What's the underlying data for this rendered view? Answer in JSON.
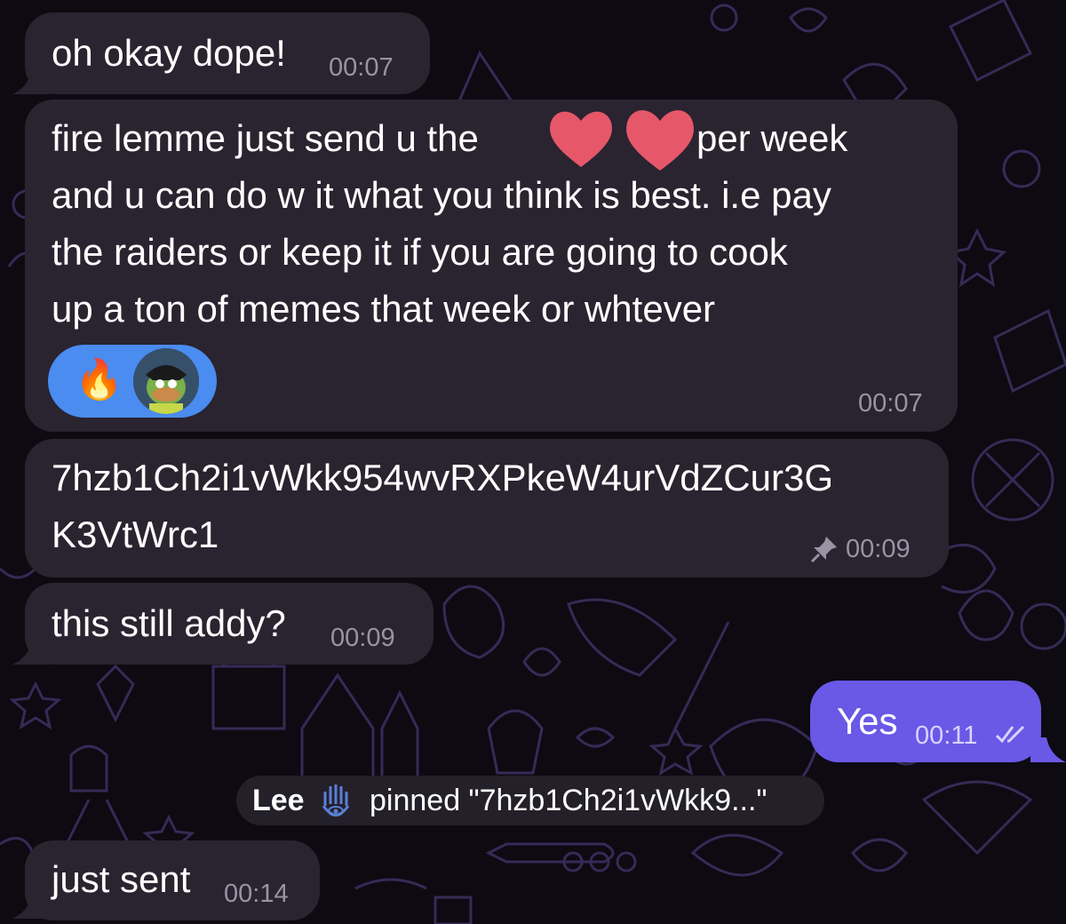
{
  "messages": [
    {
      "text": "oh okay dope!",
      "time": "00:07"
    },
    {
      "lines": [
        "fire lemme just send u the",
        "per week",
        "and u can do w it what you think is best. i.e pay",
        "the raiders or keep it if you are going to cook",
        "up a ton of memes that week or whtever"
      ],
      "time": "00:07",
      "reactions": [
        {
          "icon": "fire-emoji"
        },
        {
          "icon": "user-avatar"
        }
      ]
    },
    {
      "lines": [
        "7hzb1Ch2i1vWkk954wvRXPkeW4urVdZCur3G",
        "K3VtWrc1"
      ],
      "time": "00:09",
      "pinned_icon": "pin-icon"
    },
    {
      "text": "this still addy?",
      "time": "00:09"
    },
    {
      "text": "Yes",
      "time": "00:11",
      "status_icon": "double-check-icon"
    },
    {
      "text": "just sent",
      "time": "00:14"
    }
  ],
  "pin_notice": {
    "user": "Lee",
    "user_icon": "hamsa-hand-icon",
    "text": "pinned \"7hzb1Ch2i1vWkk9...\""
  },
  "colors": {
    "background": "#0d0a12",
    "incoming_bubble": "#2a2330",
    "outgoing_bubble": "#6a58e6",
    "reaction_pill": "#4a8cf0",
    "timestamp": "#9a93a3",
    "heart": "#e6576a"
  }
}
